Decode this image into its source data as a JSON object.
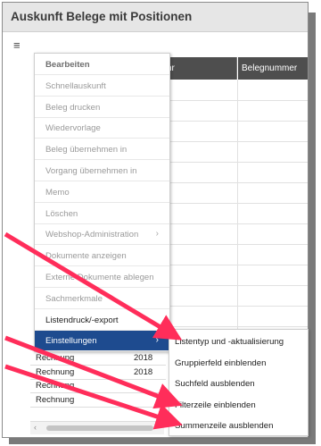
{
  "window": {
    "title": "Auskunft Belege mit Positionen"
  },
  "toolbar": {
    "menu_icon": "hamburger-menu-icon",
    "menu_glyph": "≡"
  },
  "grid": {
    "columns": [
      "hr",
      "Belegnummer"
    ],
    "rows": [
      {
        "type": "Rechnung",
        "year": "2018"
      },
      {
        "type": "Rechnung",
        "year": "2018"
      },
      {
        "type": "Rechnung",
        "year": ""
      },
      {
        "type": "Rechnung",
        "year": ""
      }
    ]
  },
  "menu": {
    "items": [
      {
        "label": "Bearbeiten",
        "state": "header"
      },
      {
        "label": "Schnellauskunft",
        "state": "disabled"
      },
      {
        "label": "Beleg drucken",
        "state": "disabled"
      },
      {
        "label": "Wiedervorlage",
        "state": "disabled"
      },
      {
        "label": "Beleg übernehmen in",
        "state": "disabled"
      },
      {
        "label": "Vorgang übernehmen in",
        "state": "disabled"
      },
      {
        "label": "Memo",
        "state": "disabled"
      },
      {
        "label": "Löschen",
        "state": "disabled"
      },
      {
        "label": "Webshop-Administration",
        "state": "disabled",
        "submenu": true
      },
      {
        "label": "Dokumente anzeigen",
        "state": "disabled"
      },
      {
        "label": "Externe Dokumente ablegen",
        "state": "disabled"
      },
      {
        "label": "Sachmerkmale",
        "state": "disabled"
      },
      {
        "label": "Listendruck/-export",
        "state": "enabled"
      },
      {
        "label": "Einstellungen",
        "state": "active",
        "submenu": true
      }
    ],
    "chevron": "›"
  },
  "submenu": {
    "items": [
      {
        "label": "Listentyp und -aktualisierung"
      },
      {
        "label": "Gruppierfeld einblenden"
      },
      {
        "label": "Suchfeld ausblenden"
      },
      {
        "label": "Filterzeile einblenden"
      },
      {
        "label": "Summenzeile ausblenden"
      }
    ]
  },
  "scrollbar": {
    "left_arrow": "‹"
  },
  "colors": {
    "accent": "#1e4b8f",
    "arrow": "#ff2d5a",
    "header_bg": "#4e4e4e"
  }
}
